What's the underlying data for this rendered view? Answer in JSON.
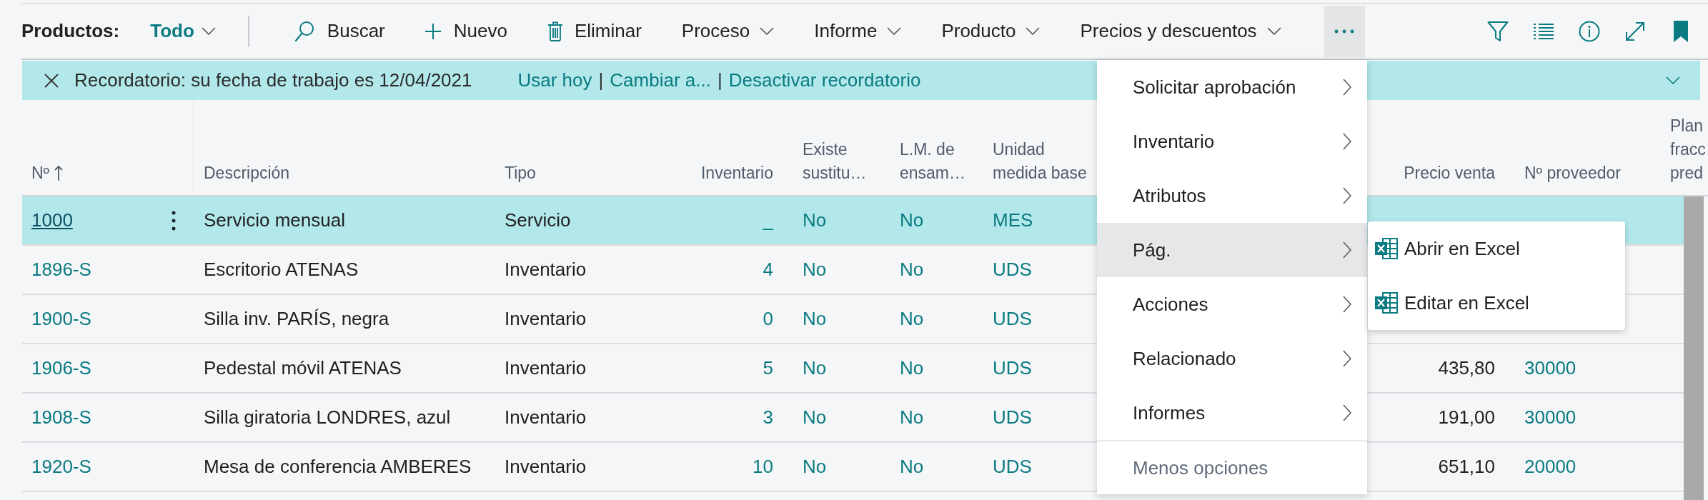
{
  "toolbar": {
    "title": "Productos:",
    "view": {
      "label": "Todo"
    },
    "actions": [
      {
        "kind": "search",
        "label": "Buscar"
      },
      {
        "kind": "new",
        "label": "Nuevo"
      },
      {
        "kind": "delete",
        "label": "Eliminar"
      },
      {
        "kind": "dropdown",
        "label": "Proceso"
      },
      {
        "kind": "dropdown",
        "label": "Informe"
      },
      {
        "kind": "dropdown",
        "label": "Producto"
      },
      {
        "kind": "dropdown",
        "label": "Precios y descuentos"
      }
    ],
    "more_actions": {
      "expanded": true
    }
  },
  "reminder": {
    "message": "Recordatorio: su fecha de trabajo es 12/04/2021",
    "links": [
      {
        "kind": "link",
        "label": "Usar hoy"
      },
      {
        "kind": "separator",
        "label": "|"
      },
      {
        "kind": "link",
        "label": "Cambiar a..."
      },
      {
        "kind": "separator",
        "label": "|"
      },
      {
        "kind": "link",
        "label": "Desactivar recordatorio"
      }
    ]
  },
  "table": {
    "columns": [
      {
        "label": "Nº",
        "sorted": true
      },
      {
        "label": "Descripción",
        "sorted": false
      },
      {
        "label": "Tipo",
        "sorted": false
      },
      {
        "label": "Inventario",
        "sorted": false
      },
      {
        "label": "Existe sustitu…",
        "sorted": false
      },
      {
        "label": "L.M. de ensam…",
        "sorted": false
      },
      {
        "label": "Unidad medida base",
        "sorted": false
      },
      {
        "label": "Precio venta",
        "sorted": false
      },
      {
        "label": "Nº proveedor",
        "sorted": false
      },
      {
        "label": "Plan fracc pred",
        "sorted": false
      }
    ],
    "rows": [
      {
        "selected": true,
        "no": "1000",
        "description": "Servicio mensual",
        "type": "Servicio",
        "inventory": "_",
        "substitutes": "No",
        "assembly_bom": "No",
        "base_unit": "MES"
      },
      {
        "selected": false,
        "no": "1896-S",
        "description": "Escritorio ATENAS",
        "type": "Inventario",
        "inventory": "4",
        "substitutes": "No",
        "assembly_bom": "No",
        "base_unit": "UDS"
      },
      {
        "selected": false,
        "no": "1900-S",
        "description": "Silla inv. PARÍS, negra",
        "type": "Inventario",
        "inventory": "0",
        "substitutes": "No",
        "assembly_bom": "No",
        "base_unit": "UDS"
      },
      {
        "selected": false,
        "no": "1906-S",
        "description": "Pedestal móvil ATENAS",
        "type": "Inventario",
        "inventory": "5",
        "substitutes": "No",
        "assembly_bom": "No",
        "base_unit": "UDS",
        "unit_price": "435,80",
        "vendor_no": "30000"
      },
      {
        "selected": false,
        "no": "1908-S",
        "description": "Silla giratoria LONDRES, azul",
        "type": "Inventario",
        "inventory": "3",
        "substitutes": "No",
        "assembly_bom": "No",
        "base_unit": "UDS",
        "unit_price": "191,00",
        "vendor_no": "30000"
      },
      {
        "selected": false,
        "no": "1920-S",
        "description": "Mesa de conferencia AMBERES",
        "type": "Inventario",
        "inventory": "10",
        "substitutes": "No",
        "assembly_bom": "No",
        "base_unit": "UDS",
        "unit_price": "651,10",
        "vendor_no": "20000"
      }
    ]
  },
  "menu": {
    "items": [
      {
        "kind": "submenu",
        "label": "Solicitar aprobación",
        "expanded": false
      },
      {
        "kind": "submenu",
        "label": "Inventario",
        "expanded": false
      },
      {
        "kind": "submenu",
        "label": "Atributos",
        "expanded": false
      },
      {
        "kind": "submenu",
        "label": "Pág.",
        "expanded": true
      },
      {
        "kind": "submenu",
        "label": "Acciones",
        "expanded": false
      },
      {
        "kind": "submenu",
        "label": "Relacionado",
        "expanded": false
      },
      {
        "kind": "submenu",
        "label": "Informes",
        "expanded": false
      },
      {
        "kind": "toggle",
        "label": "Menos opciones"
      }
    ]
  },
  "submenu": {
    "items": [
      {
        "label": "Abrir en Excel"
      },
      {
        "label": "Editar en Excel"
      }
    ]
  }
}
